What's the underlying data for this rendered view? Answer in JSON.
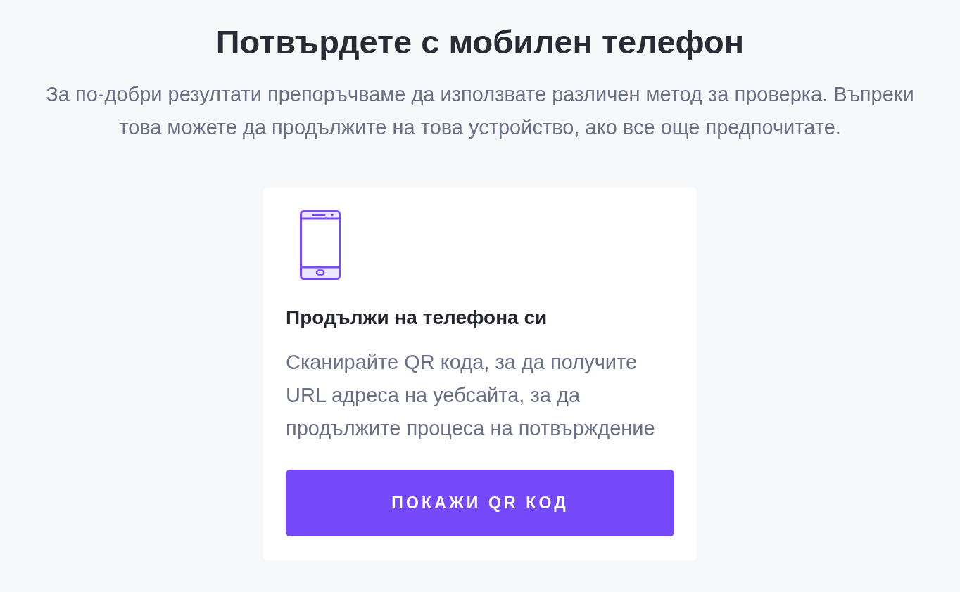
{
  "title": "Потвърдете с мобилен телефон",
  "subtitle": "За по-добри резултати препоръчваме да използвате различен метод за проверка. Въпреки това можете да продължите на това устройство, ако все още предпочитате.",
  "option_card": {
    "heading": "Продължи на телефона си",
    "description": "Сканирайте QR кода, за да получите URL адреса на уебсайта, за да продължите процеса на потвърждение",
    "button": "ПОКАЖИ QR КОД"
  }
}
